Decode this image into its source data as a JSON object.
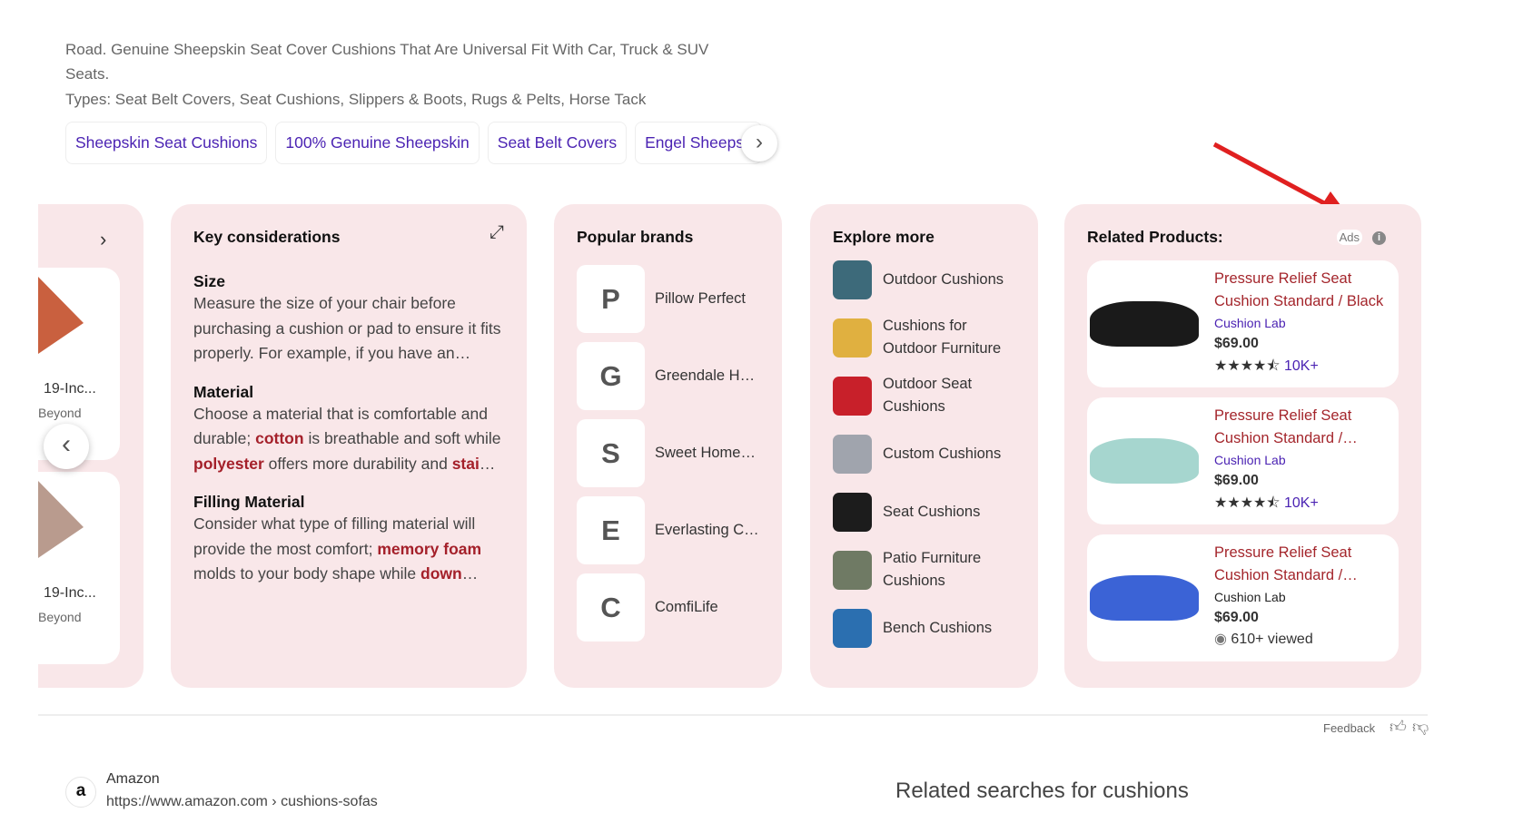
{
  "description": {
    "line1": "Road. Genuine Sheepskin Seat Cover Cushions That Are Universal Fit With Car, Truck & SUV",
    "line2": "Seats.",
    "types": "Types: Seat Belt Covers, Seat Cushions, Slippers & Boots, Rugs & Pelts, Horse Tack"
  },
  "chips": [
    "Sheepskin Seat Cushions",
    "100% Genuine Sheepskin",
    "Seat Belt Covers",
    "Engel Sheepskin"
  ],
  "left_carousel": {
    "items": [
      {
        "title": "19-Inc...",
        "store": "Beyond",
        "color": "#c9603f"
      },
      {
        "title": "19-Inc...",
        "store": "Beyond",
        "color": "#b99b8e"
      }
    ]
  },
  "key_considerations": {
    "title": "Key considerations",
    "sections": [
      {
        "heading": "Size",
        "parts": [
          {
            "t": "Measure the size of your chair before purchasing a cushion or pad to ensure it fits properly. For example, if you have an…"
          }
        ]
      },
      {
        "heading": "Material",
        "parts": [
          {
            "t": "Choose a material that is comfortable and durable; "
          },
          {
            "b": "cotton"
          },
          {
            "t": " is breathable and soft while "
          },
          {
            "b": "polyester"
          },
          {
            "t": " offers more durability and "
          },
          {
            "b": "stai"
          },
          {
            "t": "…"
          }
        ]
      },
      {
        "heading": "Filling Material",
        "parts": [
          {
            "t": "Consider what type of filling material will provide the most comfort; "
          },
          {
            "b": "memory foam"
          },
          {
            "t": " molds to your body shape while "
          },
          {
            "b": "down"
          },
          {
            "t": "…"
          }
        ]
      }
    ]
  },
  "popular_brands": {
    "title": "Popular brands",
    "items": [
      {
        "letter": "P",
        "name": "Pillow Perfect"
      },
      {
        "letter": "G",
        "name": "Greendale Home Fashions"
      },
      {
        "letter": "S",
        "name": "Sweet Home Collection"
      },
      {
        "letter": "E",
        "name": "Everlasting Comfort"
      },
      {
        "letter": "C",
        "name": "ComfiLife"
      }
    ]
  },
  "explore_more": {
    "title": "Explore more",
    "items": [
      {
        "label": "Outdoor Cushions",
        "color": "#3d6a7a"
      },
      {
        "label": "Cushions for Outdoor Furniture",
        "color": "#e0b040"
      },
      {
        "label": "Outdoor Seat Cushions",
        "color": "#c8202a"
      },
      {
        "label": "Custom Cushions",
        "color": "#a0a4ad"
      },
      {
        "label": "Seat Cushions",
        "color": "#1c1c1c"
      },
      {
        "label": "Patio Furniture Cushions",
        "color": "#6f7a64"
      },
      {
        "label": "Bench Cushions",
        "color": "#2b6fb0"
      }
    ]
  },
  "related_products": {
    "title": "Related Products:",
    "ads_label": "Ads",
    "items": [
      {
        "title": "Pressure Relief Seat Cushion Standard / Black",
        "store": "Cushion Lab",
        "price": "$69.00",
        "rating": 4.5,
        "stars": "★★★★⯪",
        "count": "10K+",
        "color": "#1a1a1a"
      },
      {
        "title": "Pressure Relief Seat Cushion Standard /…",
        "store": "Cushion Lab",
        "price": "$69.00",
        "rating": 4.5,
        "stars": "★★★★⯪",
        "count": "10K+",
        "color": "#a6d6cf"
      },
      {
        "title": "Pressure Relief Seat Cushion Standard /…",
        "store": "Cushion Lab",
        "price": "$69.00",
        "viewed": "610+ viewed",
        "color": "#3b63d6"
      }
    ]
  },
  "feedback": {
    "label": "Feedback"
  },
  "result": {
    "site": "Amazon",
    "url": "https://www.amazon.com › cushions-sofas"
  },
  "related_searches": {
    "title": "Related searches for cushions"
  },
  "colors": {
    "panel": "#f9e7e9",
    "link": "#4b23b3",
    "product_title": "#a4262c",
    "annotation_arrow": "#e02020"
  }
}
